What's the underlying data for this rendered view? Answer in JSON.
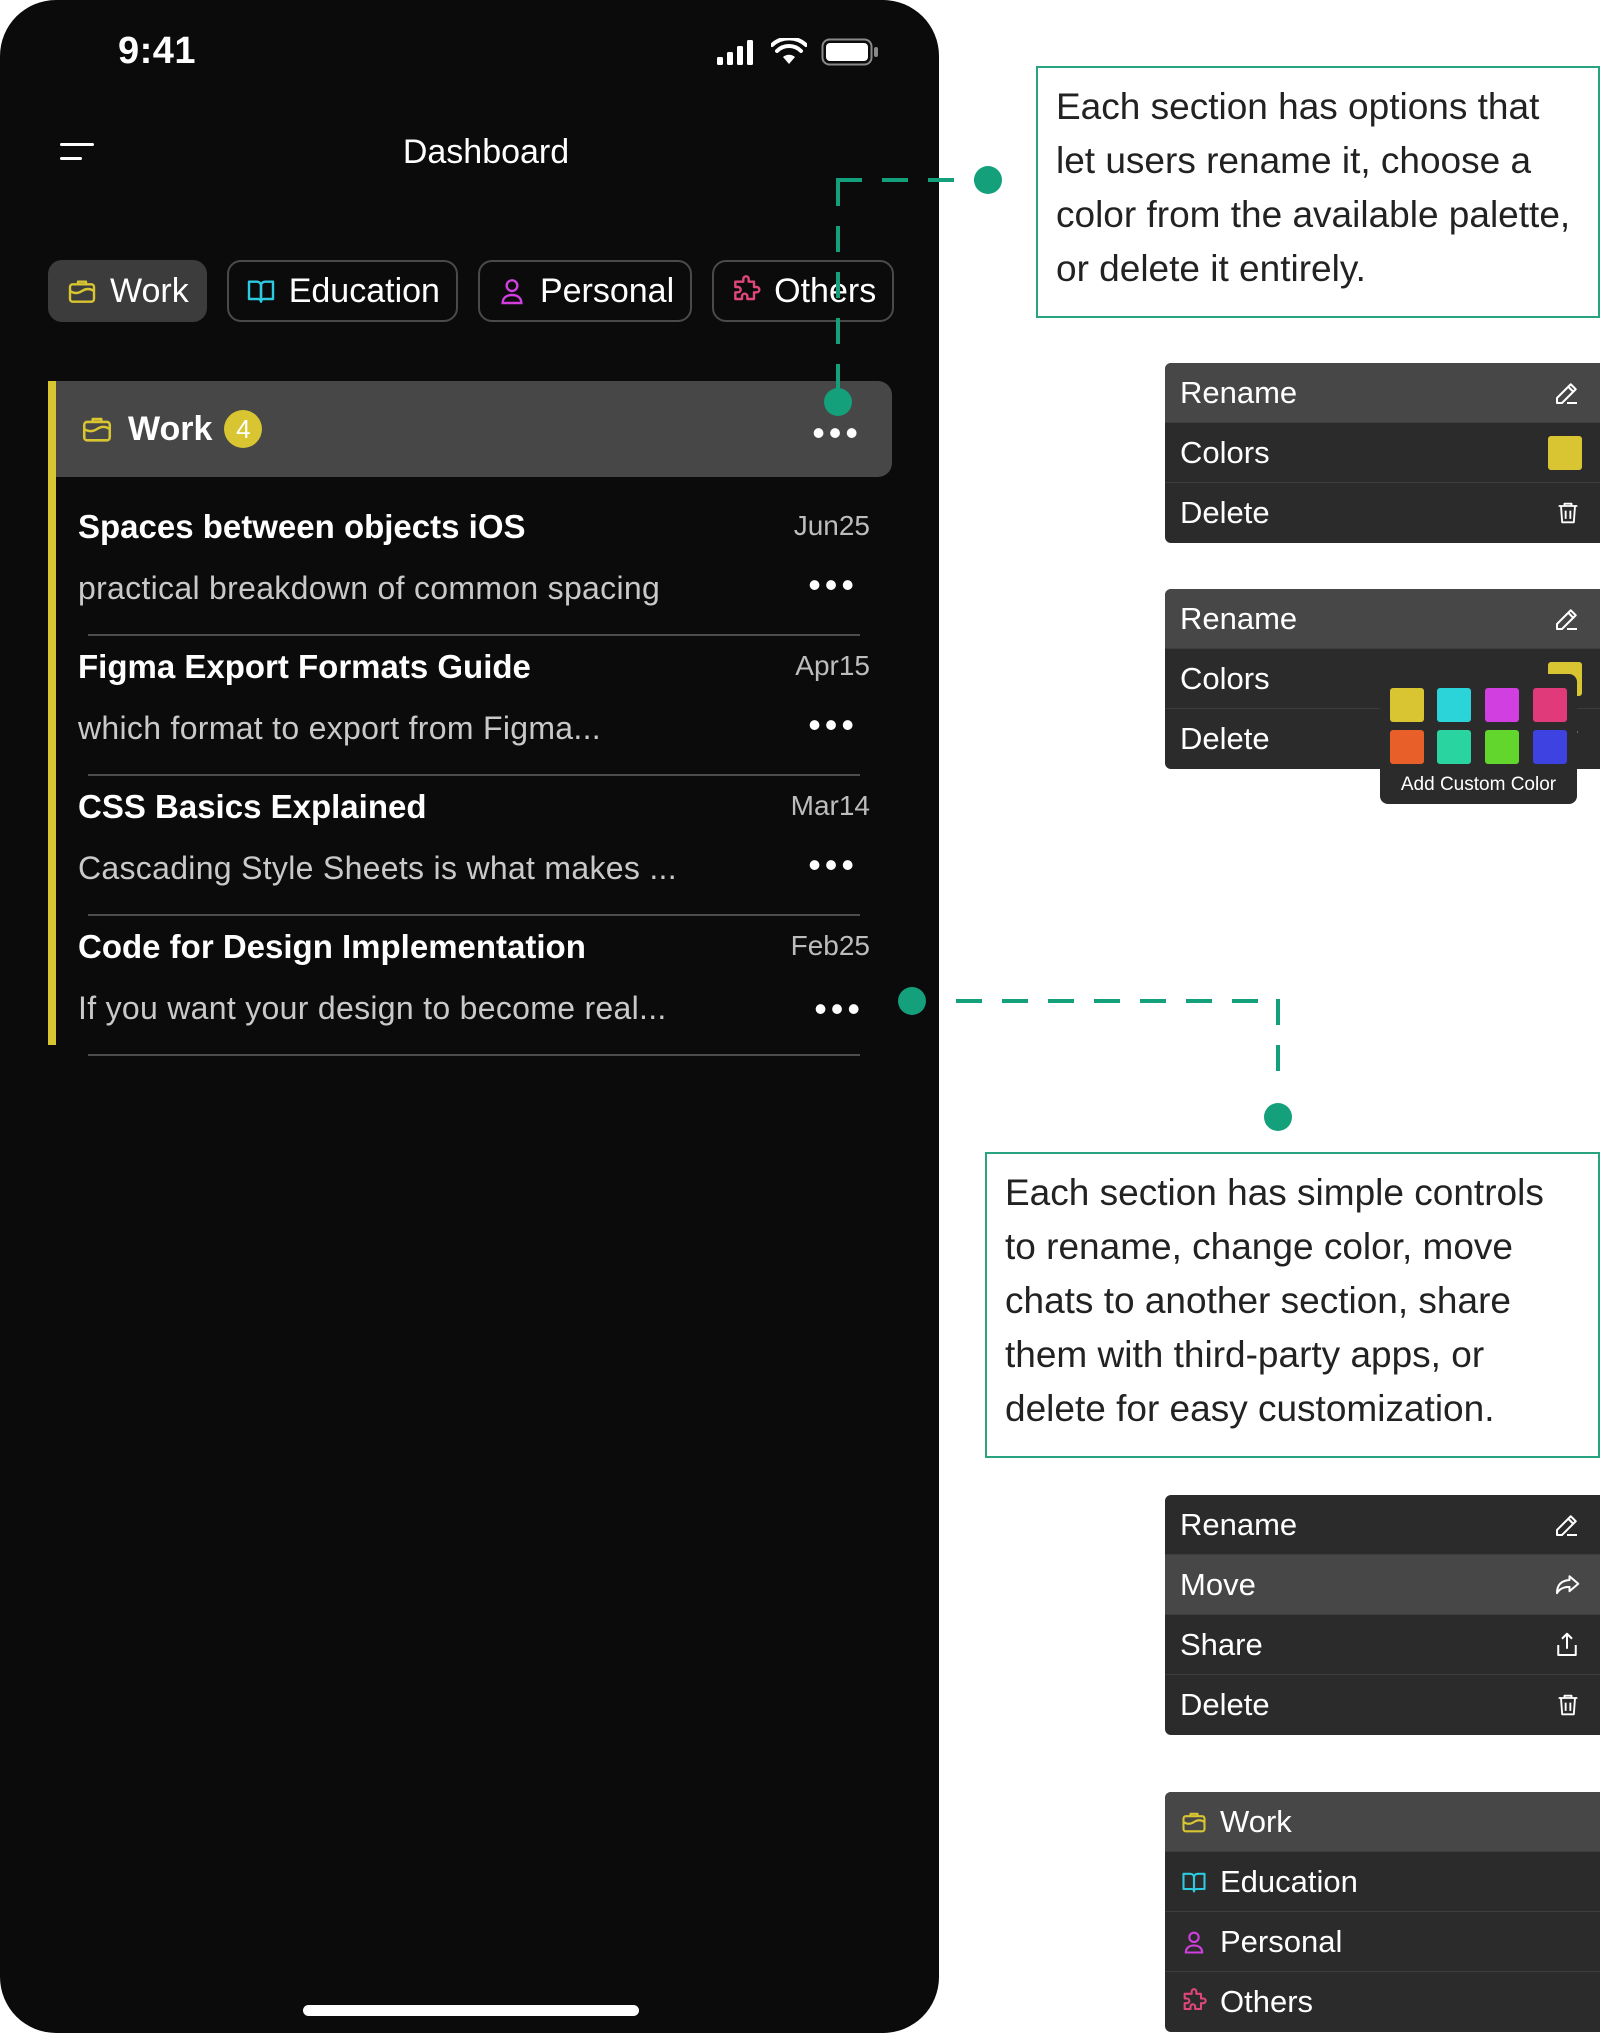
{
  "status_bar": {
    "time": "9:41"
  },
  "header": {
    "title": "Dashboard"
  },
  "tabs": [
    {
      "label": "Work",
      "color": "#d8c531",
      "icon": "briefcase-icon"
    },
    {
      "label": "Education",
      "color": "#2ecae0",
      "icon": "book-icon"
    },
    {
      "label": "Personal",
      "color": "#d13fe0",
      "icon": "person-icon"
    },
    {
      "label": "Others",
      "color": "#e0467c",
      "icon": "puzzle-icon"
    }
  ],
  "section": {
    "title": "Work",
    "count": "4",
    "color": "#d8c531"
  },
  "chats": [
    {
      "title": "Spaces between objects iOS",
      "date": "Jun25",
      "preview": "practical breakdown of common spacing"
    },
    {
      "title": "Figma Export Formats Guide",
      "date": "Apr15",
      "preview": "which format to export from Figma..."
    },
    {
      "title": "CSS Basics Explained",
      "date": "Mar14",
      "preview": "Cascading Style Sheets is what makes ..."
    },
    {
      "title": "Code for Design Implementation",
      "date": "Feb25",
      "preview": "If you want your design to become real..."
    }
  ],
  "callouts": {
    "top": "Each section has options that let users rename it, choose a color from the available palette, or delete it entirely.",
    "bottom": "Each section has simple controls to rename, change color, move chats to another section, share them with third-party apps, or delete for easy customization."
  },
  "section_menu": {
    "rename": "Rename",
    "colors": "Colors",
    "delete": "Delete"
  },
  "palette": {
    "colors": [
      "#d8c531",
      "#2ad4d8",
      "#d23fe0",
      "#e03a7a",
      "#e85f2a",
      "#2ad4a0",
      "#62d62c",
      "#3d42e0"
    ],
    "custom_label": "Add Custom Color"
  },
  "chat_menu": {
    "rename": "Rename",
    "move": "Move",
    "share": "Share",
    "delete": "Delete"
  },
  "move_targets": [
    {
      "label": "Work",
      "color": "#d8c531"
    },
    {
      "label": "Education",
      "color": "#2ecae0"
    },
    {
      "label": "Personal",
      "color": "#d13fe0"
    },
    {
      "label": "Others",
      "color": "#e0467c"
    }
  ]
}
